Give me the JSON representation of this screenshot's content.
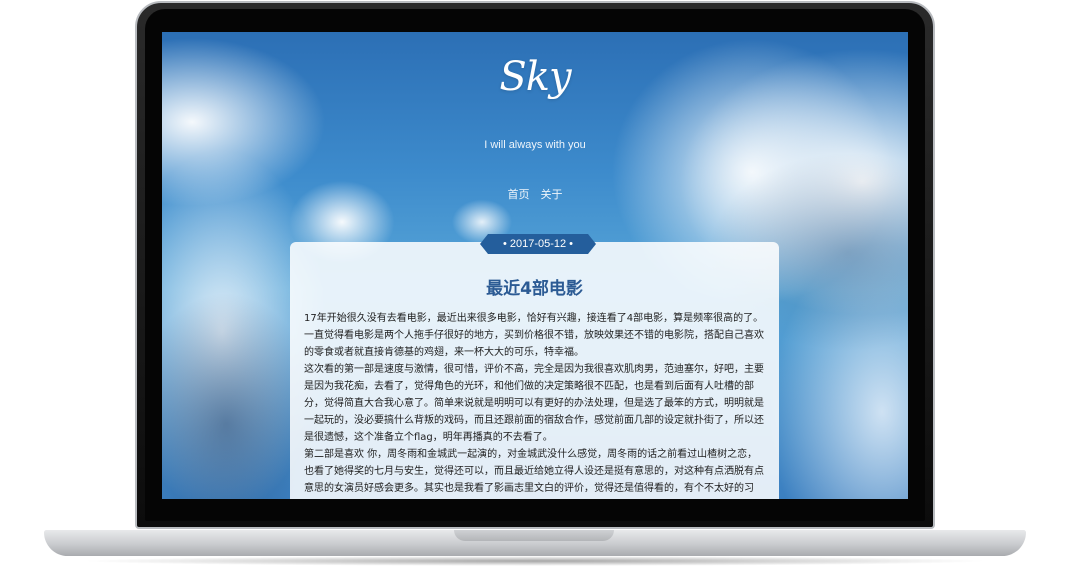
{
  "site": {
    "logo": "Sky",
    "tagline": "I will always with you",
    "nav": [
      "首页",
      "关于"
    ]
  },
  "post": {
    "date": "• 2017-05-12 •",
    "title": "最近4部电影",
    "paragraphs": [
      "17年开始很久没有去看电影，最近出来很多电影，恰好有兴趣，接连看了4部电影，算是频率很高的了。",
      "一直觉得看电影是两个人拖手仔很好的地方，买到价格很不错，放映效果还不错的电影院，搭配自己喜欢的零食或者就直接肯德基的鸡翅，来一杯大大的可乐，特幸福。",
      "这次看的第一部是速度与激情，很可惜，评价不高，完全是因为我很喜欢肌肉男，范迪塞尔，好吧，主要是因为我花痴，去看了，觉得角色的光环，和他们做的决定策略很不匹配，也是看到后面有人吐槽的部分，觉得简直大合我心意了。简单来说就是明明可以有更好的办法处理，但是选了最笨的方式，明明就是一起玩的，没必要搞什么背叛的戏码，而且还跟前面的宿敌合作，感觉前面几部的设定就扑街了，所以还是很遗憾，这个准备立个flag，明年再播真的不去看了。",
      "第二部是喜欢 你，周冬雨和金城武一起演的，对金城武没什么感觉，周冬雨的话之前看过山楂树之恋，也看了她得奖的七月与安生，觉得还可以，而且最近给她立得人设还是挺有意思的，对这种有点洒脱有点意思的女演员好感会更多。其实也是我看了影画志里文白的评价，觉得还是值得看的，有个不太好的习惯，总觉得"
    ]
  },
  "colors": {
    "ribbon": "#245e9c",
    "title": "#2c5b94",
    "sky": "#3d8bcc"
  }
}
